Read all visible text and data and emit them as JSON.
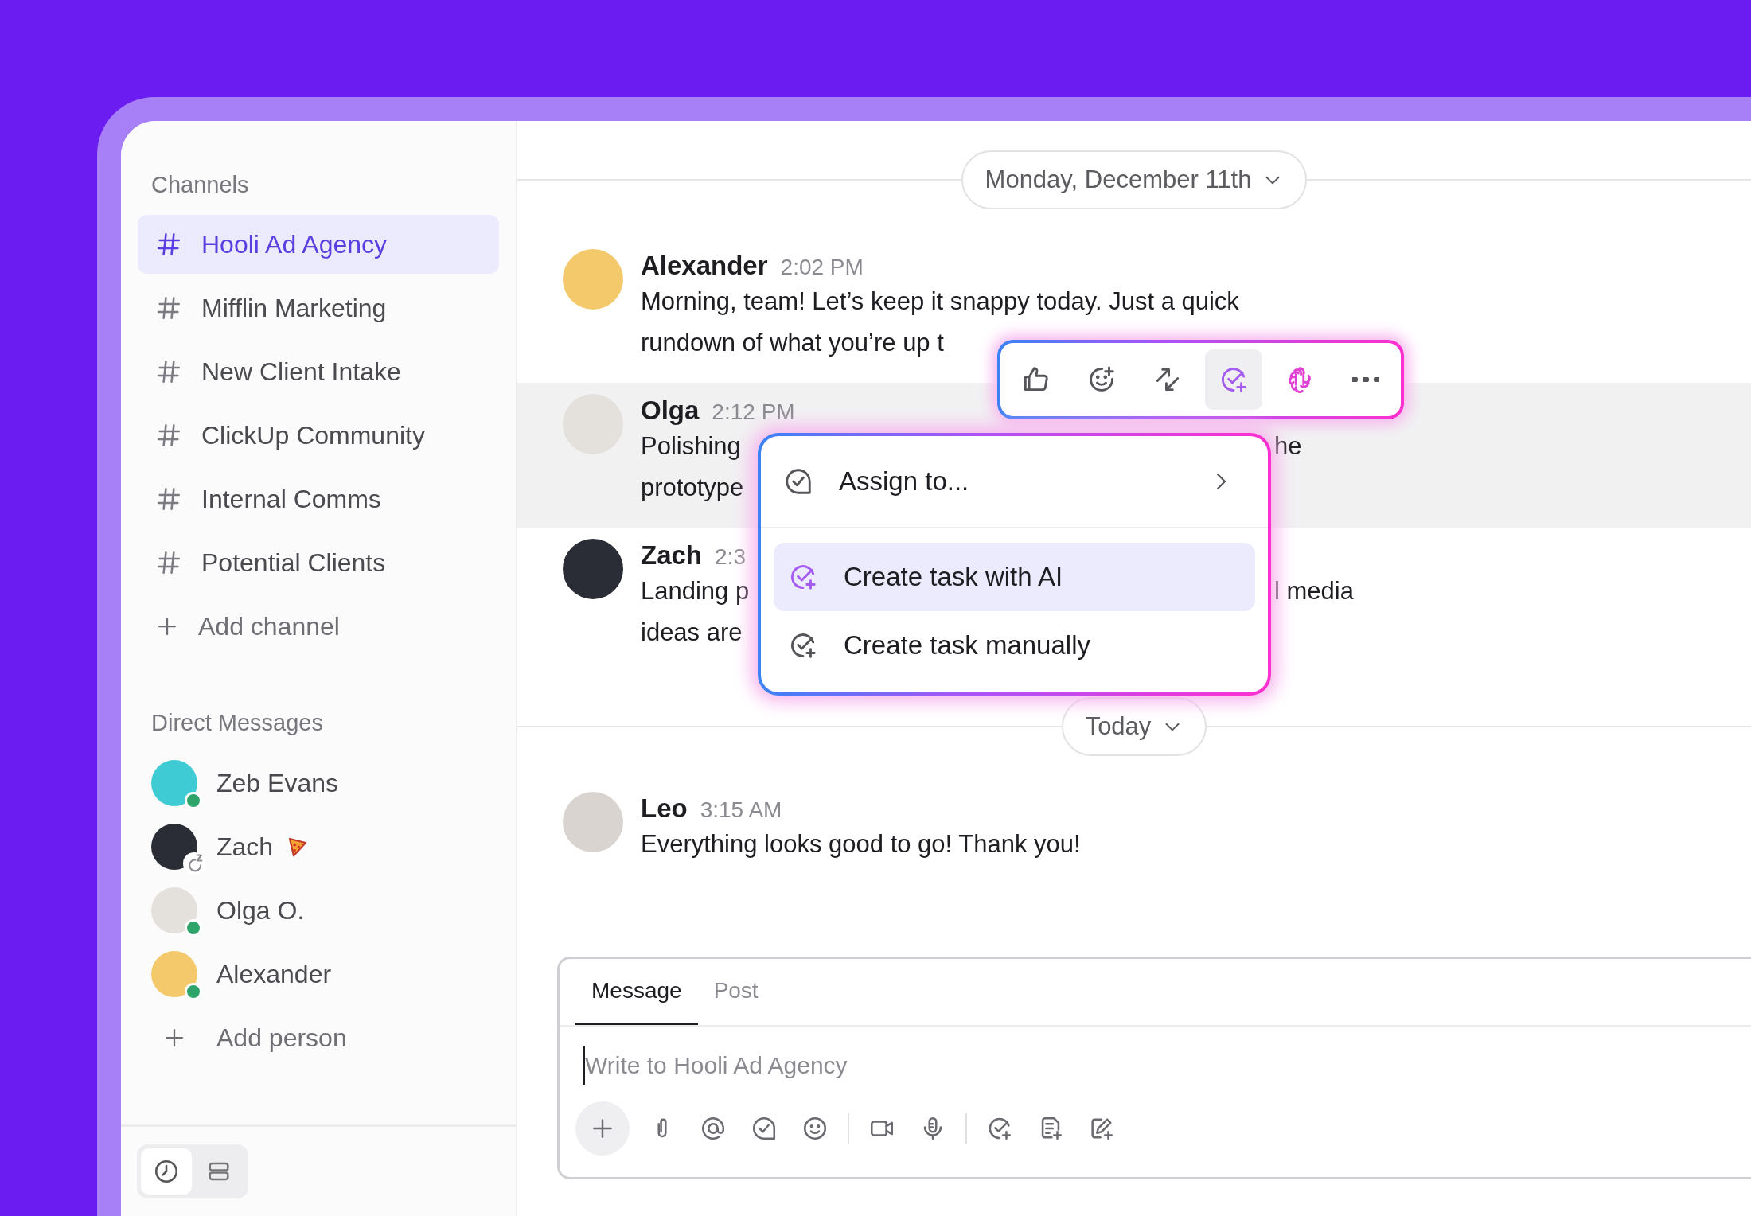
{
  "sidebar": {
    "channels_heading": "Channels",
    "channels": [
      {
        "label": "Hooli Ad Agency",
        "selected": true
      },
      {
        "label": "Mifflin Marketing",
        "selected": false
      },
      {
        "label": "New Client Intake",
        "selected": false
      },
      {
        "label": "ClickUp Community",
        "selected": false
      },
      {
        "label": "Internal Comms",
        "selected": false
      },
      {
        "label": "Potential Clients",
        "selected": false
      }
    ],
    "add_channel": "Add channel",
    "dm_heading": "Direct Messages",
    "direct_messages": [
      {
        "name": "Zeb Evans",
        "online": true,
        "snoozed": false,
        "color": "#3ecbd3",
        "status_emoji": false
      },
      {
        "name": "Zach",
        "online": false,
        "snoozed": true,
        "color": "#2a2d35",
        "status_emoji": true
      },
      {
        "name": "Olga O.",
        "online": true,
        "snoozed": false,
        "color": "#e4e1dc",
        "status_emoji": false
      },
      {
        "name": "Alexander",
        "online": true,
        "snoozed": false,
        "color": "#f4c96c",
        "status_emoji": false
      }
    ],
    "add_person": "Add person",
    "view_toggle": [
      {
        "kind": "clock",
        "selected": true
      },
      {
        "kind": "list",
        "selected": false
      }
    ]
  },
  "chat": {
    "timeline": [
      {
        "kind": "date",
        "label": "Monday, December 11th"
      },
      {
        "kind": "message",
        "author": "Alexander",
        "time": "2:02 PM",
        "color": "#f4c96c",
        "highlighted": false,
        "lines": [
          [
            "Morning, team! Let’s keep it snappy today. Just a quick"
          ],
          [
            "rundown of what you’re up t"
          ]
        ]
      },
      {
        "kind": "message",
        "author": "Olga",
        "time": "2:12 PM",
        "color": "#e4e1dc",
        "highlighted": true,
        "lines": [
          [
            "Polishing",
            "he"
          ],
          [
            "prototype"
          ]
        ]
      },
      {
        "kind": "message",
        "author": "Zach",
        "time": "2:3",
        "color": "#2a2d35",
        "highlighted": false,
        "lines": [
          [
            "Landing p",
            "l media"
          ],
          [
            "ideas are"
          ]
        ]
      },
      {
        "kind": "date",
        "label": "Today"
      },
      {
        "kind": "message",
        "author": "Leo",
        "time": "3:15 AM",
        "color": "#d9d4cf",
        "highlighted": false,
        "lines": [
          [
            "Everything looks good to go! Thank you!"
          ]
        ]
      }
    ],
    "message_actions": [
      {
        "kind": "like",
        "selected": false
      },
      {
        "kind": "emoji",
        "selected": false
      },
      {
        "kind": "arrows",
        "selected": false
      },
      {
        "kind": "task",
        "selected": true
      },
      {
        "kind": "ai",
        "selected": false
      },
      {
        "kind": "more",
        "selected": false
      }
    ],
    "task_menu": [
      {
        "kind": "assign",
        "label": "Assign to...",
        "selected": false
      },
      {
        "kind": "ai",
        "label": "Create task with AI",
        "selected": true
      },
      {
        "kind": "manual",
        "label": "Create task manually",
        "selected": false
      }
    ],
    "composer": {
      "tabs": [
        {
          "label": "Message",
          "selected": true
        },
        {
          "label": "Post",
          "selected": false
        }
      ],
      "placeholder": "Write to Hooli Ad Agency",
      "tools": [
        {
          "kind": "plus"
        },
        {
          "kind": "clip"
        },
        {
          "kind": "at"
        },
        {
          "kind": "check"
        },
        {
          "kind": "smile"
        },
        {
          "kind": "divider"
        },
        {
          "kind": "video"
        },
        {
          "kind": "mic"
        },
        {
          "kind": "divider"
        },
        {
          "kind": "taskplus"
        },
        {
          "kind": "docplus"
        },
        {
          "kind": "editplus"
        }
      ]
    }
  }
}
